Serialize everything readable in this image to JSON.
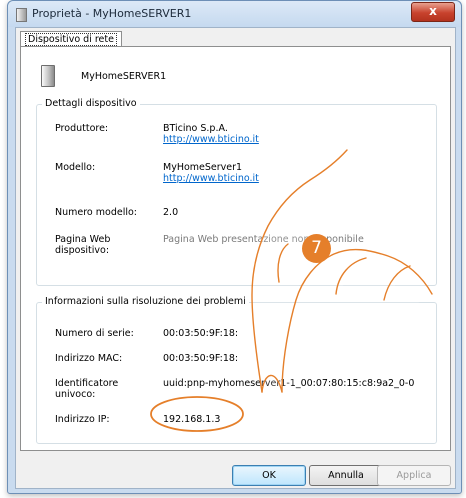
{
  "window": {
    "title": "Proprietà - MyHomeSERVER1",
    "close_glyph": "x"
  },
  "tabs": [
    {
      "label": "Dispositivo di rete"
    }
  ],
  "device": {
    "name": "MyHomeSERVER1"
  },
  "details": {
    "title": "Dettagli dispositivo",
    "manufacturer_label": "Produttore:",
    "manufacturer_value": "BTicino S.p.A.",
    "manufacturer_link": "http://www.bticino.it",
    "model_label": "Modello:",
    "model_value": "MyHomeServer1",
    "model_link": "http://www.bticino.it",
    "model_number_label": "Numero modello:",
    "model_number_value": "2.0",
    "web_page_label_1": "Pagina Web",
    "web_page_label_2": "dispositivo:",
    "web_page_value": "Pagina Web presentazione non disponibile"
  },
  "troubleshooting": {
    "title": "Informazioni sulla risoluzione dei problemi",
    "serial_label": "Numero di serie:",
    "serial_value": "00:03:50:9F:18:",
    "mac_label": "Indirizzo MAC:",
    "mac_value": "00:03:50:9F:18:",
    "uid_label_1": "Identificatore",
    "uid_label_2": "univoco:",
    "uid_value": "uuid:pnp-myhomeserver1-1_00:07:80:15:c8:9a2_0-0",
    "ip_label": "Indirizzo IP:",
    "ip_value": "192.168.1.3"
  },
  "buttons": {
    "ok": "OK",
    "cancel": "Annulla",
    "apply": "Applica"
  },
  "annotation": {
    "step_number": "7",
    "accent_color": "#e57f2a"
  },
  "icons": {
    "title": "window-icon",
    "device": "network-device-icon",
    "close": "close-icon",
    "pointer": "hand-pointer-icon"
  }
}
